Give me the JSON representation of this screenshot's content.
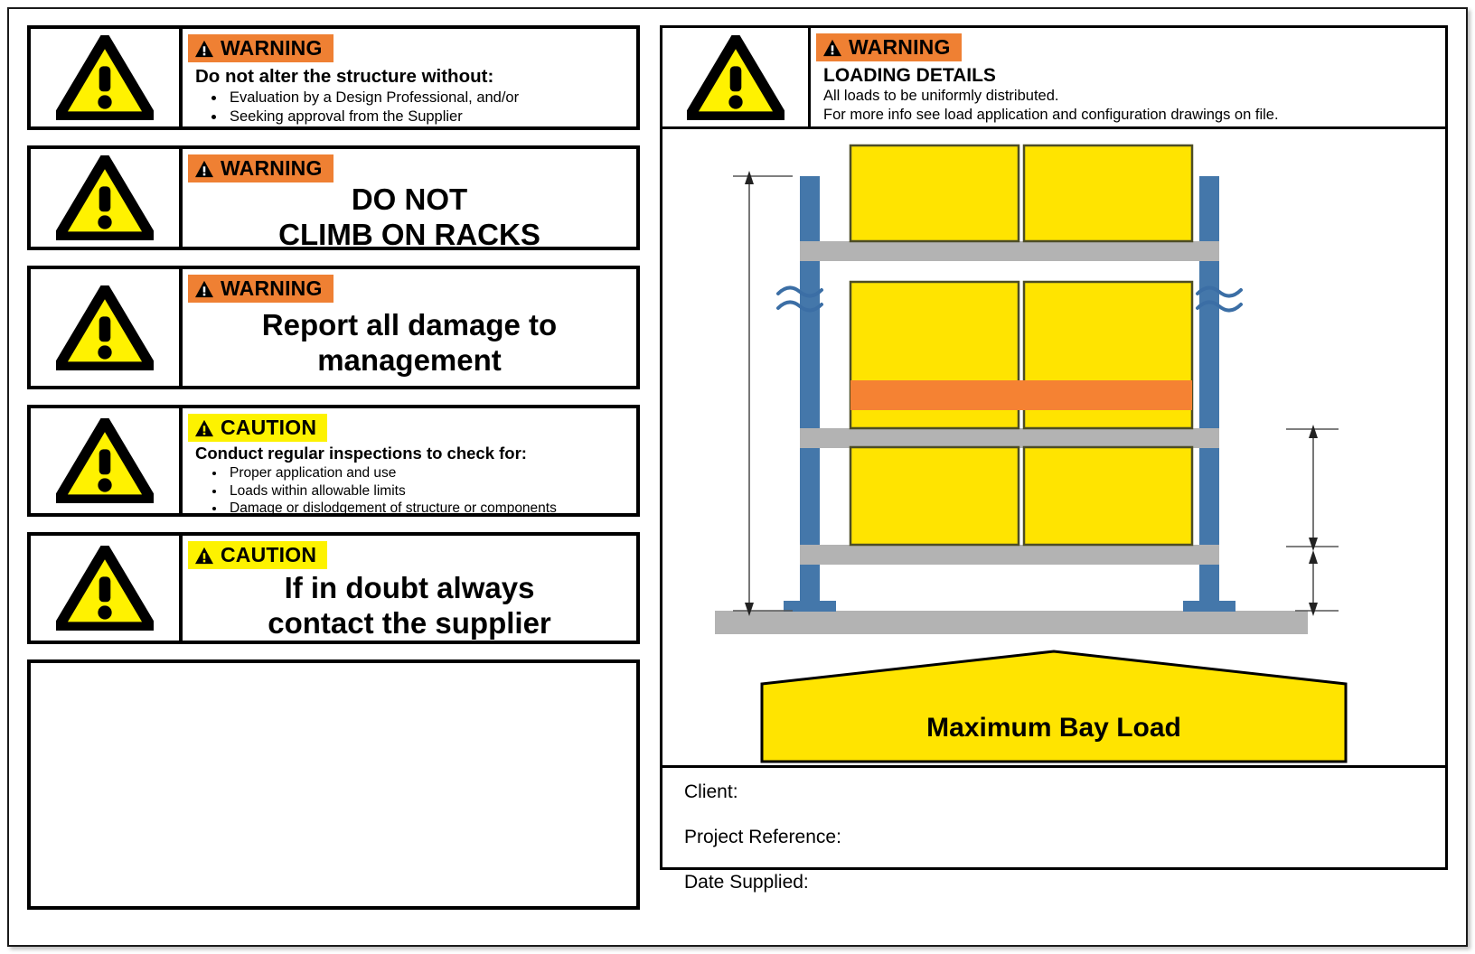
{
  "document": {
    "type": "rack-safety-and-loading-placard"
  },
  "colors": {
    "warning_banner": "#EF8033",
    "caution_banner": "#FDF200",
    "triangle_yellow": "#FFF200",
    "pallet_yellow": "#FFE400",
    "upright_blue": "#4477AA",
    "beam_grey": "#B3B3B3",
    "accent_orange": "#F58233",
    "outline_black": "#000000"
  },
  "left_panels": [
    {
      "id": "alter-structure",
      "level": "WARNING",
      "level_label": "WARNING",
      "icon": "warning-triangle-icon",
      "banner_icon": "banner-triangle-icon",
      "heading": "Do not alter the structure without:",
      "bullets": [
        "Evaluation by a Design Professional, and/or",
        "Seeking approval from the Supplier"
      ],
      "centered_lines": []
    },
    {
      "id": "do-not-climb",
      "level": "WARNING",
      "level_label": "WARNING",
      "icon": "warning-triangle-icon",
      "banner_icon": "banner-triangle-icon",
      "heading": "",
      "bullets": [],
      "centered_lines": [
        "DO NOT",
        "CLIMB ON RACKS"
      ]
    },
    {
      "id": "report-damage",
      "level": "WARNING",
      "level_label": "WARNING",
      "icon": "warning-triangle-icon",
      "banner_icon": "banner-triangle-icon",
      "heading": "",
      "bullets": [],
      "centered_lines": [
        "Report all damage to",
        "management"
      ]
    },
    {
      "id": "regular-inspections",
      "level": "CAUTION",
      "level_label": "CAUTION",
      "icon": "warning-triangle-icon",
      "banner_icon": "banner-triangle-icon",
      "heading": "Conduct regular inspections to check for:",
      "bullets": [
        "Proper application and use",
        "Loads within allowable limits",
        "Damage or dislodgement of structure or components"
      ],
      "centered_lines": []
    },
    {
      "id": "if-in-doubt",
      "level": "CAUTION",
      "level_label": "CAUTION",
      "icon": "warning-triangle-icon",
      "banner_icon": "banner-triangle-icon",
      "heading": "",
      "bullets": [],
      "centered_lines": [
        "If in doubt always",
        "contact the supplier"
      ]
    }
  ],
  "blank_panel": {
    "id": "blank-notes-panel",
    "content": ""
  },
  "loading_details": {
    "level_label": "WARNING",
    "icon": "warning-triangle-icon",
    "banner_icon": "banner-triangle-icon",
    "title": "LOADING DETAILS",
    "line1": "All loads to be uniformly distributed.",
    "line2": "For more info see load application and configuration drawings on file."
  },
  "diagram": {
    "name": "pallet-rack-elevation-diagram",
    "max_bay_load_label": "Maximum Bay Load",
    "levels": 3,
    "pallets_per_level": 2,
    "break_symbols": 2,
    "dimension_arrows": [
      {
        "name": "overall-height-dimension",
        "side": "left",
        "label": ""
      },
      {
        "name": "beam-level-height-dimension",
        "side": "right",
        "label": ""
      },
      {
        "name": "floor-clearance-dimension",
        "side": "right",
        "label": ""
      }
    ]
  },
  "client_fields": [
    {
      "name": "client-field",
      "label": "Client:",
      "value": ""
    },
    {
      "name": "project-reference-field",
      "label": "Project Reference:",
      "value": ""
    },
    {
      "name": "date-supplied-field",
      "label": "Date Supplied:",
      "value": ""
    }
  ]
}
